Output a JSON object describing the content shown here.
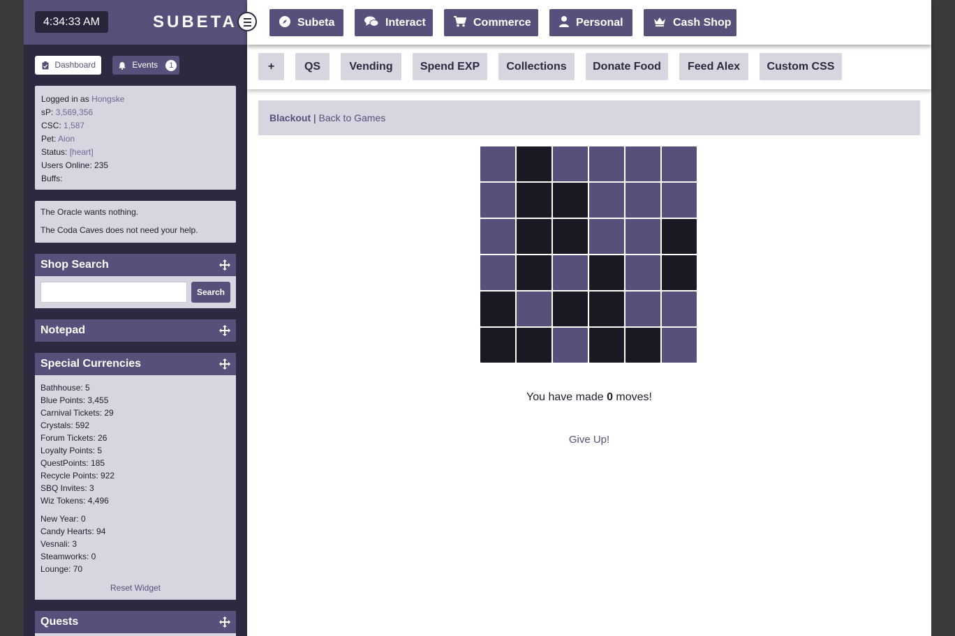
{
  "clock": "4:34:33 AM",
  "brand": "SUBETA",
  "sidebar": {
    "dashboard_label": "Dashboard",
    "events_label": "Events",
    "events_count": "1",
    "user": {
      "logged_in_label": "Logged in as",
      "username": "Hongske",
      "sp_label": "sP:",
      "sp_value": "3,569,356",
      "csc_label": "CSC:",
      "csc_value": "1,587",
      "pet_label": "Pet:",
      "pet_value": "Aion",
      "status_label": "Status:",
      "status_value": "[heart]",
      "users_online": "Users Online: 235",
      "buffs": "Buffs:"
    },
    "oracle": [
      "The Oracle wants nothing.",
      "The Coda Caves does not need your help."
    ],
    "shop_search": {
      "title": "Shop Search",
      "button": "Search",
      "value": ""
    },
    "notepad": {
      "title": "Notepad"
    },
    "special_currencies": {
      "title": "Special Currencies",
      "items": [
        "Bathhouse: 5",
        "Blue Points: 3,455",
        "Carnival Tickets: 29",
        "Crystals: 592",
        "Forum Tickets: 26",
        "Loyalty Points: 5",
        "QuestPoints: 185",
        "Recycle Points: 922",
        "SBQ Invites: 3",
        "Wiz Tokens: 4,496"
      ],
      "event_items": [
        "New Year: 0",
        "Candy Hearts: 94",
        "Vesnali: 3",
        "Steamworks: 0",
        "Lounge: 70"
      ],
      "reset": "Reset Widget"
    },
    "quests": {
      "title": "Quests"
    }
  },
  "topnav": [
    {
      "label": "Subeta",
      "icon": "compass-icon"
    },
    {
      "label": "Interact",
      "icon": "chat-icon"
    },
    {
      "label": "Commerce",
      "icon": "cart-icon"
    },
    {
      "label": "Personal",
      "icon": "user-icon"
    },
    {
      "label": "Cash Shop",
      "icon": "crown-icon"
    }
  ],
  "subnav": [
    "+",
    "QS",
    "Vending",
    "Spend EXP",
    "Collections",
    "Donate Food",
    "Feed Alex",
    "Custom CSS"
  ],
  "breadcrumb": {
    "current": "Blackout",
    "separator": "|",
    "back": "Back to Games"
  },
  "game": {
    "grid": [
      [
        0,
        1,
        0,
        0,
        0,
        0
      ],
      [
        0,
        1,
        1,
        0,
        0,
        0
      ],
      [
        0,
        1,
        1,
        0,
        0,
        1
      ],
      [
        0,
        1,
        0,
        1,
        0,
        1
      ],
      [
        1,
        0,
        1,
        1,
        0,
        0
      ],
      [
        1,
        1,
        0,
        1,
        1,
        0
      ]
    ],
    "moves_prefix": "You have made",
    "moves_count": "0",
    "moves_suffix": "moves!",
    "give_up": "Give Up!"
  },
  "colors": {
    "accent": "#56517a",
    "dark_tile": "#191823",
    "panel": "#d6d5e0"
  }
}
